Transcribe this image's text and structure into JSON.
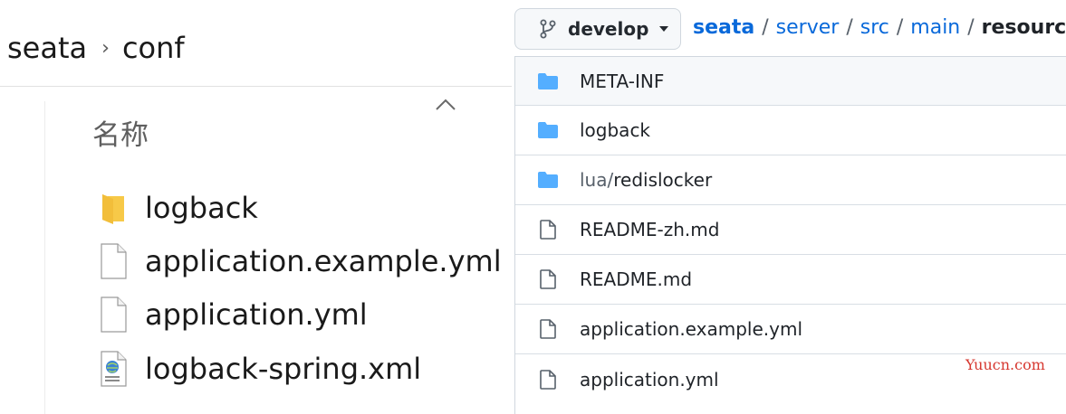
{
  "explorer": {
    "breadcrumb": [
      "seata",
      "conf"
    ],
    "breadcrumb_separator": "›",
    "column_header": "名称",
    "files": [
      {
        "name": "logback",
        "icon": "folder-icon"
      },
      {
        "name": "application.example.yml",
        "icon": "blank-file-icon"
      },
      {
        "name": "application.yml",
        "icon": "blank-file-icon"
      },
      {
        "name": "logback-spring.xml",
        "icon": "xml-file-icon"
      }
    ]
  },
  "github": {
    "branch": "develop",
    "path": {
      "parts": [
        "seata",
        "server",
        "src",
        "main"
      ],
      "current": "resources",
      "separator": "/"
    },
    "rows": [
      {
        "name": "META-INF",
        "prefix": "",
        "type": "dir"
      },
      {
        "name": "logback",
        "prefix": "",
        "type": "dir"
      },
      {
        "name": "redislocker",
        "prefix": "lua/",
        "type": "dir"
      },
      {
        "name": "README-zh.md",
        "prefix": "",
        "type": "file"
      },
      {
        "name": "README.md",
        "prefix": "",
        "type": "file"
      },
      {
        "name": "application.example.yml",
        "prefix": "",
        "type": "file"
      },
      {
        "name": "application.yml",
        "prefix": "",
        "type": "file"
      }
    ]
  },
  "watermark": "Yuucn.com",
  "colors": {
    "link": "#0969da",
    "folder_blue": "#54aeff",
    "folder_yellow": "#f7c948",
    "watermark": "#d6372f"
  }
}
